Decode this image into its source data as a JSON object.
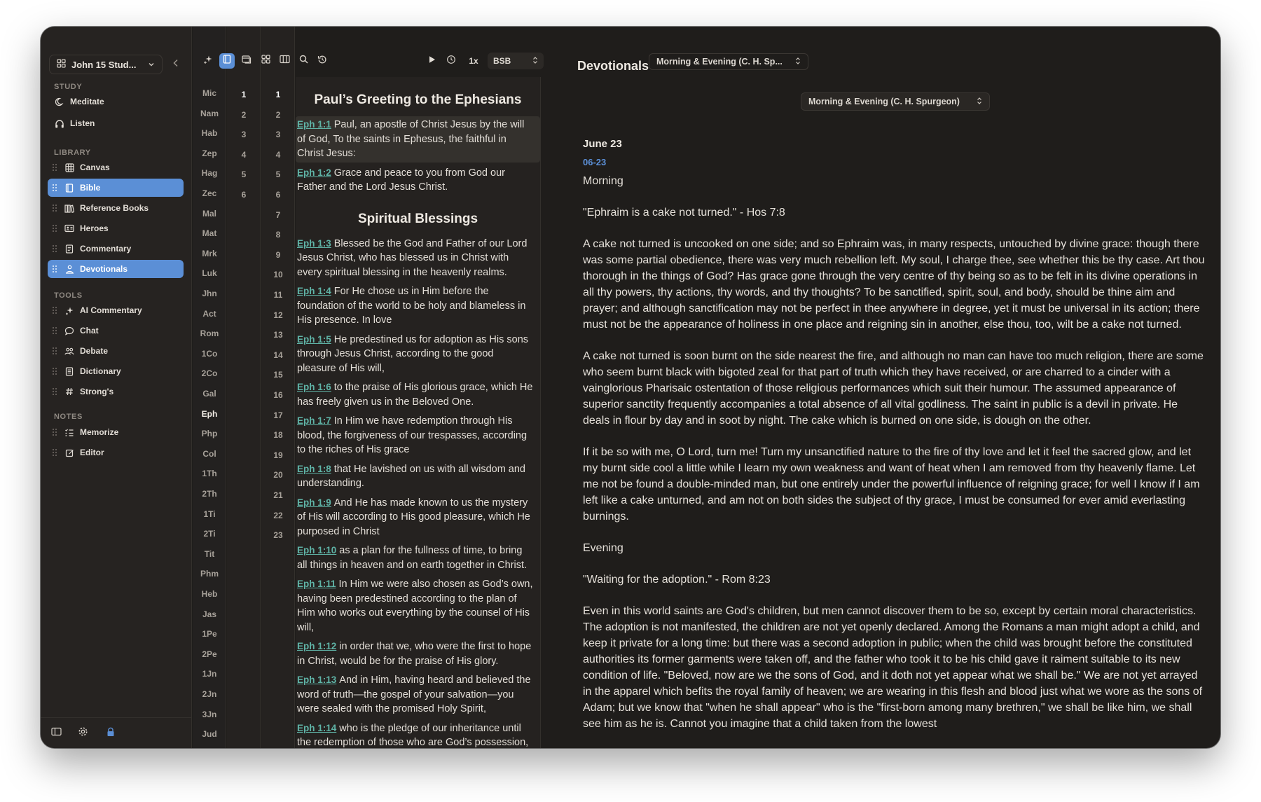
{
  "window": {
    "title": "John 15 Stud..."
  },
  "sidebar": {
    "study_switcher": "John 15 Stud...",
    "sections": {
      "study": "STUDY",
      "library": "LIBRARY",
      "tools": "TOOLS",
      "notes": "NOTES"
    },
    "study": [
      {
        "label": "Meditate",
        "icon": "moon-icon"
      },
      {
        "label": "Listen",
        "icon": "headphones-icon"
      }
    ],
    "library": [
      {
        "label": "Canvas",
        "icon": "grid-icon"
      },
      {
        "label": "Bible",
        "icon": "book-icon",
        "active": true
      },
      {
        "label": "Reference Books",
        "icon": "library-icon"
      },
      {
        "label": "Heroes",
        "icon": "id-card-icon"
      },
      {
        "label": "Commentary",
        "icon": "document-icon"
      },
      {
        "label": "Devotionals",
        "icon": "person-icon",
        "active": true
      }
    ],
    "tools": [
      {
        "label": "AI Commentary",
        "icon": "sparkle-icon"
      },
      {
        "label": "Chat",
        "icon": "chat-icon"
      },
      {
        "label": "Debate",
        "icon": "people-icon"
      },
      {
        "label": "Dictionary",
        "icon": "dictionary-icon"
      },
      {
        "label": "Strong's",
        "icon": "hash-icon"
      }
    ],
    "notes": [
      {
        "label": "Memorize",
        "icon": "checklist-icon"
      },
      {
        "label": "Editor",
        "icon": "edit-icon"
      }
    ]
  },
  "books": [
    "Mic",
    "Nam",
    "Hab",
    "Zep",
    "Hag",
    "Zec",
    "Mal",
    "Mat",
    "Mrk",
    "Luk",
    "Jhn",
    "Act",
    "Rom",
    "1Co",
    "2Co",
    "Gal",
    "Eph",
    "Php",
    "Col",
    "1Th",
    "2Th",
    "1Ti",
    "2Ti",
    "Tit",
    "Phm",
    "Heb",
    "Jas",
    "1Pe",
    "2Pe",
    "1Jn",
    "2Jn",
    "3Jn",
    "Jud"
  ],
  "selected_book": "Eph",
  "chapters": [
    "1",
    "2",
    "3",
    "4",
    "5",
    "6"
  ],
  "verse_numbers": [
    "1",
    "2",
    "3",
    "4",
    "5",
    "6",
    "7",
    "8",
    "9",
    "10",
    "11",
    "12",
    "13",
    "14",
    "15",
    "16",
    "17",
    "18",
    "19",
    "20",
    "21",
    "22",
    "23"
  ],
  "toolbar": {
    "speed": "1x",
    "translation": "BSB"
  },
  "reader": {
    "heading1": "Paul’s Greeting to the Ephesians",
    "heading2": "Spiritual Blessings",
    "verses": [
      {
        "ref": "Eph 1:1",
        "text": "Paul, an apostle of Christ Jesus by the will of God, To the saints in Ephesus, the faithful in Christ Jesus:"
      },
      {
        "ref": "Eph 1:2",
        "text": "Grace and peace to you from God our Father and the Lord Jesus Christ."
      },
      {
        "ref": "Eph 1:3",
        "text": "Blessed be the God and Father of our Lord Jesus Christ, who has blessed us in Christ with every spiritual blessing in the heavenly realms."
      },
      {
        "ref": "Eph 1:4",
        "text": "For He chose us in Him before the foundation of the world to be holy and blameless in His presence. In love"
      },
      {
        "ref": "Eph 1:5",
        "text": "He predestined us for adoption as His sons through Jesus Christ, according to the good pleasure of His will,"
      },
      {
        "ref": "Eph 1:6",
        "text": "to the praise of His glorious grace, which He has freely given us in the Beloved One."
      },
      {
        "ref": "Eph 1:7",
        "text": "In Him we have redemption through His blood, the forgiveness of our trespasses, according to the riches of His grace"
      },
      {
        "ref": "Eph 1:8",
        "text": "that He lavished on us with all wisdom and understanding."
      },
      {
        "ref": "Eph 1:9",
        "text": "And He has made known to us the mystery of His will according to His good pleasure, which He purposed in Christ"
      },
      {
        "ref": "Eph 1:10",
        "text": "as a plan for the fullness of time, to bring all things in heaven and on earth together in Christ."
      },
      {
        "ref": "Eph 1:11",
        "text": "In Him we were also chosen as God’s own, having been predestined according to the plan of Him who works out everything by the counsel of His will,"
      },
      {
        "ref": "Eph 1:12",
        "text": "in order that we, who were the first to hope in Christ, would be for the praise of His glory."
      },
      {
        "ref": "Eph 1:13",
        "text": "And in Him, having heard and believed the word of truth—the gospel of your salvation—you were sealed with the promised Holy Spirit,"
      },
      {
        "ref": "Eph 1:14",
        "text": "who is the pledge of our inheritance until the redemption of those who are God’s possession, to the praise of His glory."
      }
    ]
  },
  "devotional": {
    "panel_title": "Devotionals",
    "source_top": "Morning & Evening (C. H. Sp...",
    "source": "Morning & Evening (C. H. Spurgeon)",
    "date": "June 23",
    "code": "06-23",
    "morning": "Morning",
    "morning_quote": "\"Ephraim is a cake not turned.\" - Hos 7:8",
    "p1": "A cake not turned is uncooked on one side; and so Ephraim was, in many respects, untouched by divine grace: though there was some partial obedience, there was very much rebellion left. My soul, I charge thee, see whether this be thy case. Art thou thorough in the things of God? Has grace gone through the very centre of thy being so as to be felt in its divine operations in all thy powers, thy actions, thy words, and thy thoughts? To be sanctified, spirit, soul, and body, should be thine aim and prayer; and although sanctification may not be perfect in thee anywhere in degree, yet it must be universal in its action; there must not be the appearance of holiness in one place and reigning sin in another, else thou, too, wilt be a cake not turned.",
    "p2": "A cake not turned is soon burnt on the side nearest the fire, and although no man can have too much religion, there are some who seem burnt black with bigoted zeal for that part of truth which they have received, or are charred to a cinder with a vainglorious Pharisaic ostentation of those religious performances which suit their humour. The assumed appearance of superior sanctity frequently accompanies a total absence of all vital godliness. The saint in public is a devil in private. He deals in flour by day and in soot by night. The cake which is burned on one side, is dough on the other.",
    "p3": "If it be so with me, O Lord, turn me! Turn my unsanctified nature to the fire of thy love and let it feel the sacred glow, and let my burnt side cool a little while I learn my own weakness and want of heat when I am removed from thy heavenly flame. Let me not be found a double-minded man, but one entirely under the powerful influence of reigning grace; for well I know if I am left like a cake unturned, and am not on both sides the subject of thy grace, I must be consumed for ever amid everlasting burnings.",
    "evening": "Evening",
    "evening_quote": "\"Waiting for the adoption.\" - Rom 8:23",
    "p4": "Even in this world saints are God's children, but men cannot discover them to be so, except by certain moral characteristics. The adoption is not manifested, the children are not yet openly declared. Among the Romans a man might adopt a child, and keep it private for a long time: but there was a second adoption in public; when the child was brought before the constituted authorities its former garments were taken off, and the father who took it to be his child gave it raiment suitable to its new condition of life. \"Beloved, now are we the sons of God, and it doth not yet appear what we shall be.\" We are not yet arrayed in the apparel which befits the royal family of heaven; we are wearing in this flesh and blood just what we wore as the sons of Adam; but we know that \"when he shall appear\" who is the \"first-born among many brethren,\" we shall be like him, we shall see him as he is. Cannot you imagine that a child taken from the lowest"
  },
  "colors": {
    "accent": "#5b8fd6",
    "link": "#5fb3a6",
    "background": "#1f1d1b"
  }
}
